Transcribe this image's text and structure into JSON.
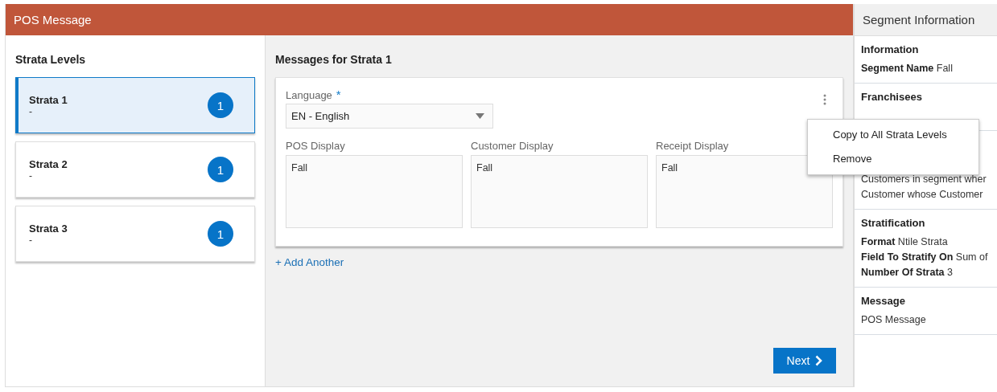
{
  "header": {
    "title": "POS Message"
  },
  "strata_panel": {
    "title": "Strata Levels",
    "items": [
      {
        "name": "Strata 1",
        "subtitle": "-",
        "count": "1",
        "selected": true
      },
      {
        "name": "Strata 2",
        "subtitle": "-",
        "count": "1",
        "selected": false
      },
      {
        "name": "Strata 3",
        "subtitle": "-",
        "count": "1",
        "selected": false
      }
    ]
  },
  "messages": {
    "title": "Messages for Strata 1",
    "language": {
      "label": "Language",
      "required_mark": "*",
      "value": "EN - English"
    },
    "displays": [
      {
        "label": "POS Display",
        "value": "Fall"
      },
      {
        "label": "Customer Display",
        "value": "Fall"
      },
      {
        "label": "Receipt Display",
        "value": "Fall"
      }
    ],
    "menu": {
      "items": [
        "Copy to All Strata Levels",
        "Remove"
      ]
    },
    "add_link": "+ Add Another",
    "next_button": "Next"
  },
  "segment_info": {
    "title": "Segment Information",
    "sections": [
      {
        "heading": "Information",
        "lines": [
          {
            "label": "Segment Name",
            "value": "Fall"
          }
        ]
      },
      {
        "heading": "Franchisees"
      },
      {
        "lines": [
          {
            "value": "Customers in segment wher"
          },
          {
            "value": "Customer whose Customer"
          }
        ]
      },
      {
        "heading": "Stratification",
        "lines": [
          {
            "label": "Format",
            "value": "Ntile Strata"
          },
          {
            "label": "Field To Stratify On",
            "value": "Sum of"
          },
          {
            "label": "Number Of Strata",
            "value": "3"
          }
        ]
      },
      {
        "heading": "Message",
        "lines": [
          {
            "value": "POS Message"
          }
        ]
      }
    ]
  }
}
